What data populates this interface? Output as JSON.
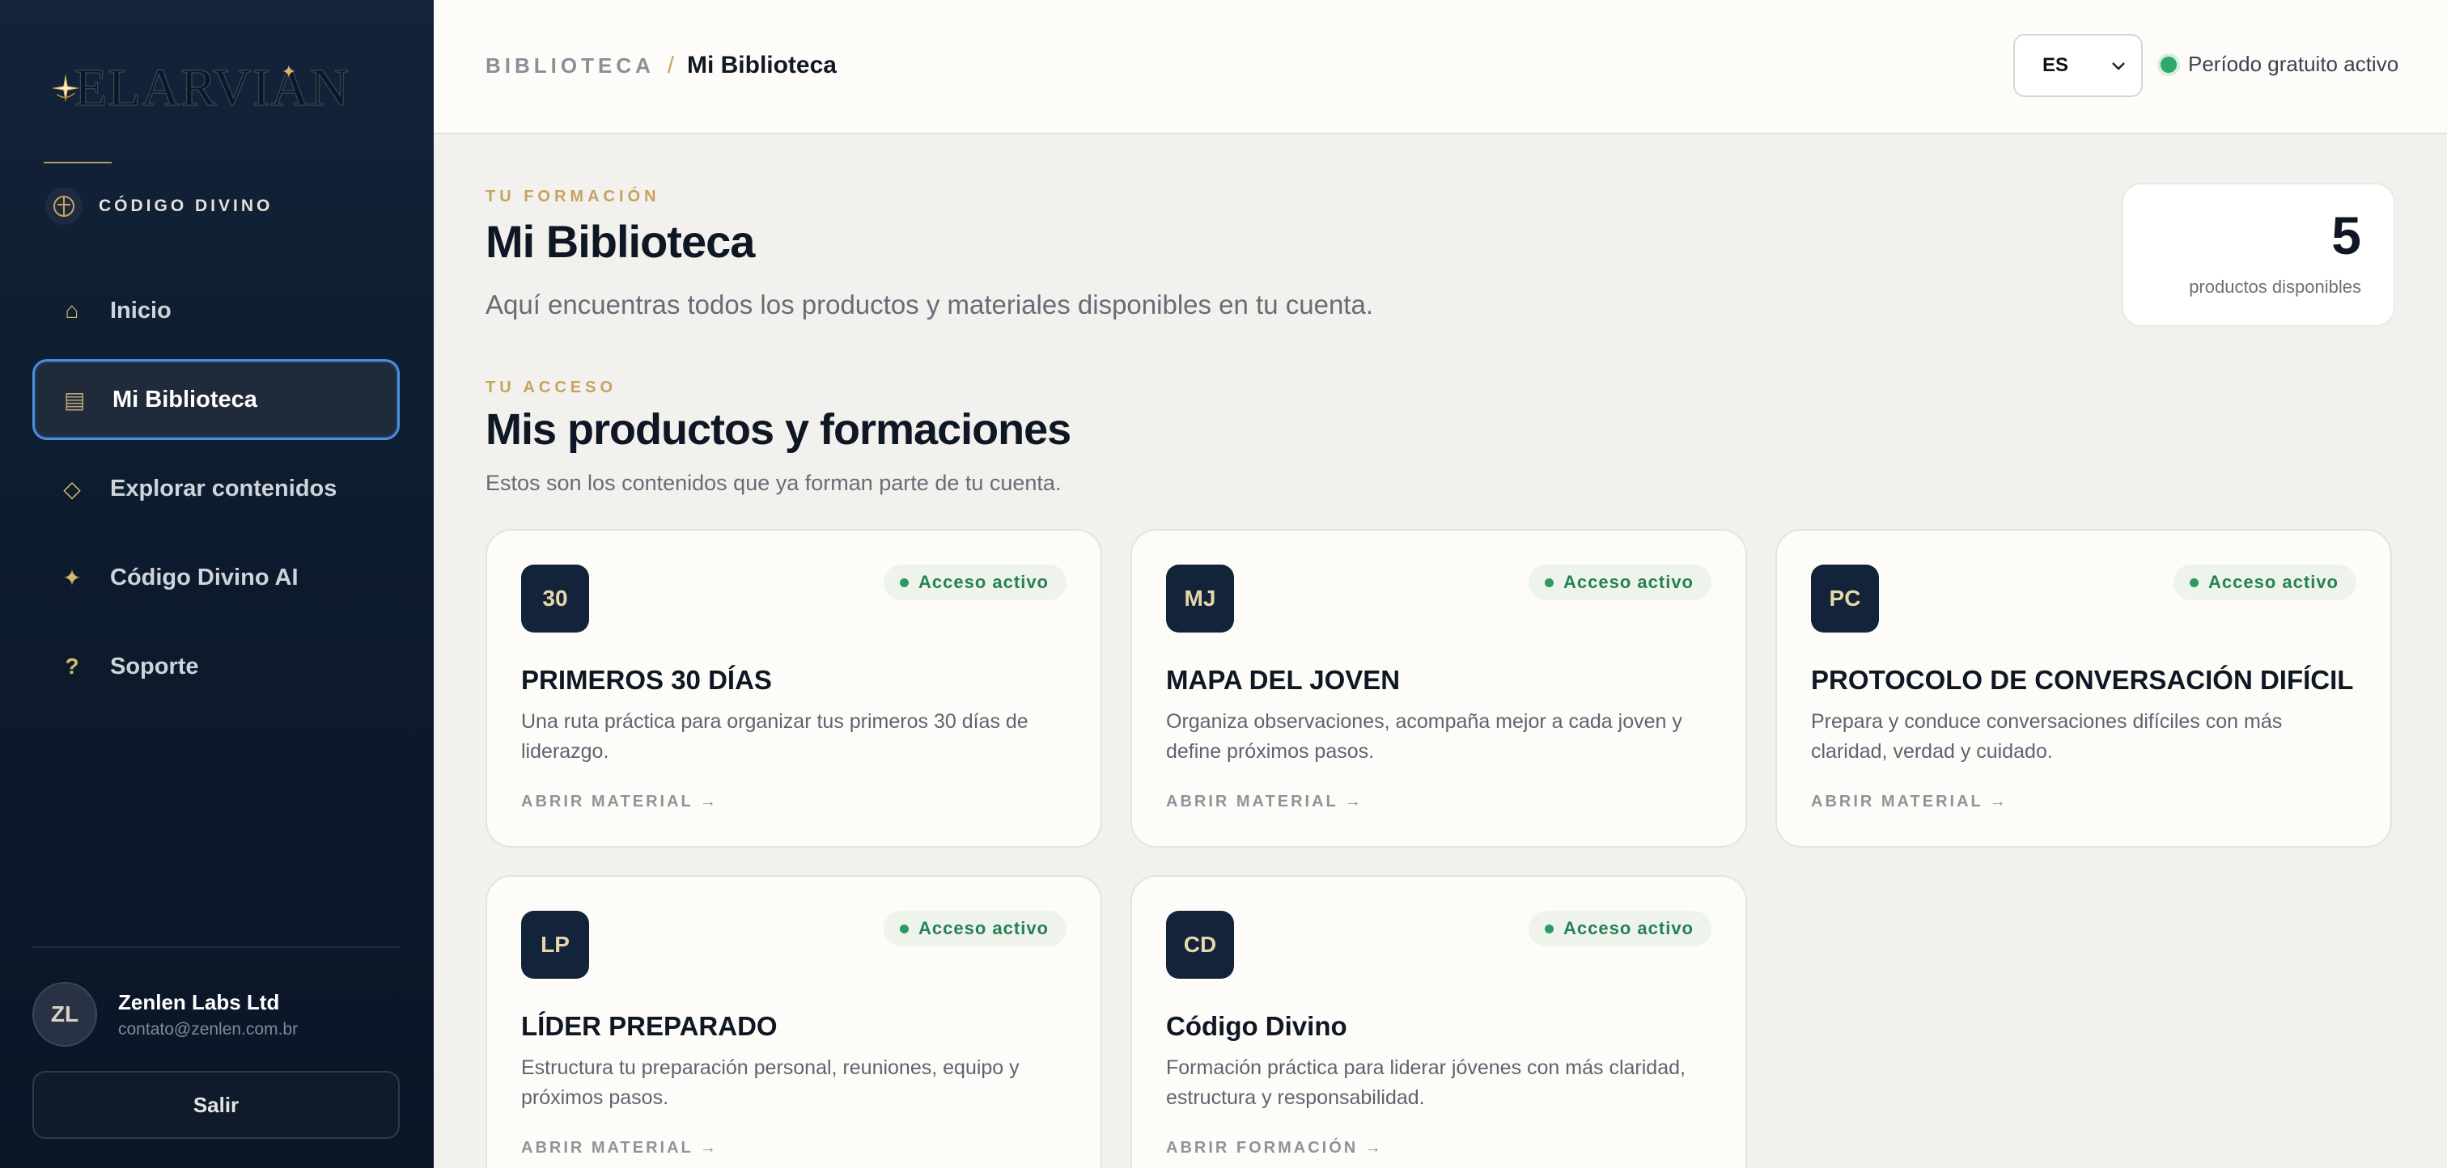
{
  "sidebar": {
    "logo_text": "ELARVIAN",
    "brand_label": "CÓDIGO DIVINO",
    "nav": [
      {
        "label": "Inicio",
        "icon": "home-icon"
      },
      {
        "label": "Mi Biblioteca",
        "icon": "library-icon",
        "active": true
      },
      {
        "label": "Explorar contenidos",
        "icon": "diamond-icon"
      },
      {
        "label": "Código Divino AI",
        "icon": "sparkle-icon"
      },
      {
        "label": "Soporte",
        "icon": "help-icon"
      }
    ],
    "user": {
      "initials": "ZL",
      "name": "Zenlen Labs Ltd",
      "email": "contato@zenlen.com.br"
    },
    "logout_label": "Salir"
  },
  "header": {
    "breadcrumb_root": "BIBLIOTECA",
    "breadcrumb_sep": "/",
    "breadcrumb_current": "Mi Biblioteca",
    "language": "ES",
    "trial_status": "Período gratuito activo"
  },
  "main": {
    "eyebrow1": "TU FORMACIÓN",
    "title": "Mi Biblioteca",
    "lead": "Aquí encuentras todos los productos y materiales disponibles en tu cuenta.",
    "count": "5",
    "count_label": "productos disponibles",
    "eyebrow2": "TU ACCESO",
    "section_title": "Mis productos y formaciones",
    "section_sub": "Estos son los contenidos que ya forman parte de tu cuenta.",
    "cards": [
      {
        "badge": "30",
        "status": "Acceso activo",
        "title": "PRIMEROS 30 DÍAS",
        "desc": "Una ruta práctica para organizar tus primeros 30 días de liderazgo.",
        "cta": "ABRIR MATERIAL →"
      },
      {
        "badge": "MJ",
        "status": "Acceso activo",
        "title": "MAPA DEL JOVEN",
        "desc": "Organiza observaciones, acompaña mejor a cada joven y define próximos pasos.",
        "cta": "ABRIR MATERIAL →"
      },
      {
        "badge": "PC",
        "status": "Acceso activo",
        "title": "PROTOCOLO DE CONVERSACIÓN DIFÍCIL",
        "desc": "Prepara y conduce conversaciones difíciles con más claridad, verdad y cuidado.",
        "cta": "ABRIR MATERIAL →"
      },
      {
        "badge": "LP",
        "status": "Acceso activo",
        "title": "LÍDER PREPARADO",
        "desc": "Estructura tu preparación personal, reuniones, equipo y próximos pasos.",
        "cta": "ABRIR MATERIAL →"
      },
      {
        "badge": "CD",
        "status": "Acceso activo",
        "title": "Código Divino",
        "desc": "Formación práctica para liderar jóvenes con más claridad, estructura y responsabilidad.",
        "cta": "ABRIR FORMACIÓN →"
      }
    ]
  },
  "colors": {
    "sidebar_bg": "#0d1b2e",
    "accent_gold": "#c7a35e",
    "active_border": "#4c8fdc",
    "status_green": "#2c9a62"
  }
}
